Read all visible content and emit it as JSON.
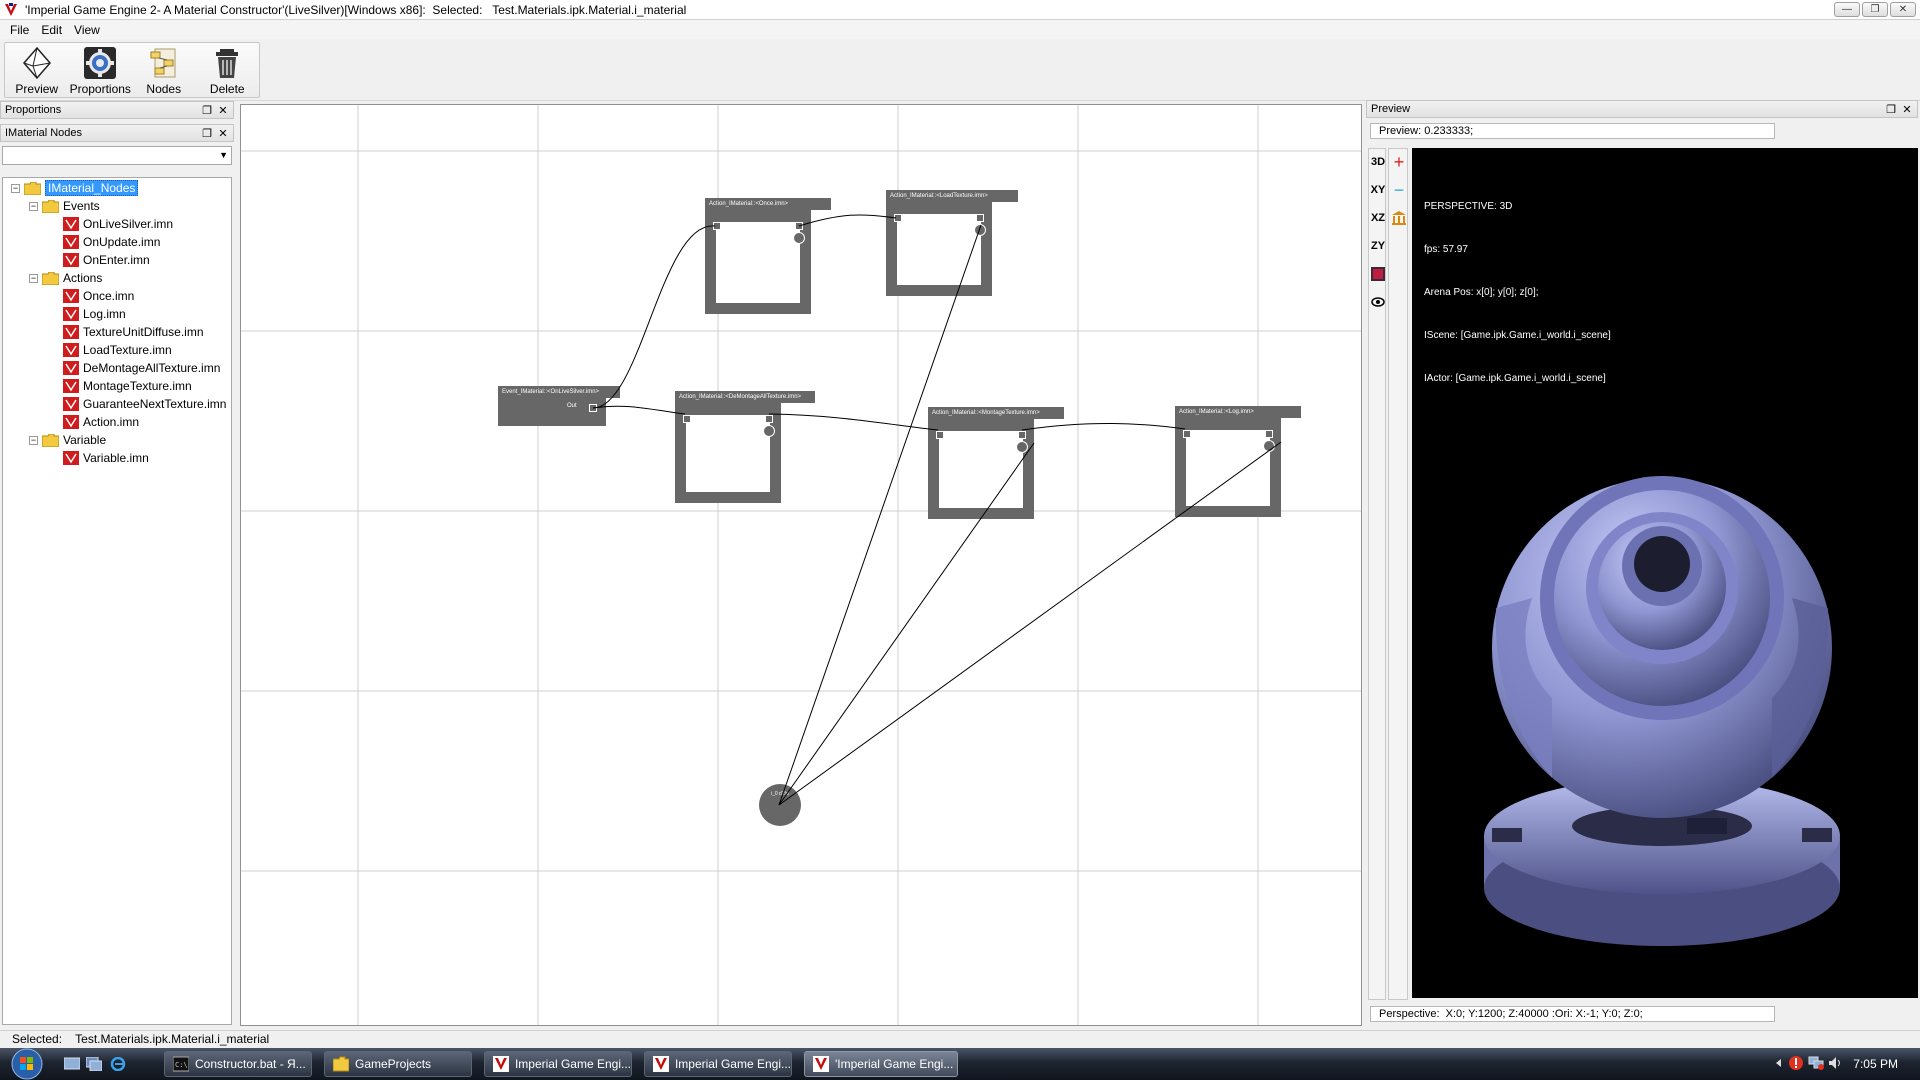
{
  "window": {
    "title": "'Imperial Game Engine 2- A Material Constructor'(LiveSilver)[Windows x86]:  Selected:   Test.Materials.ipk.Material.i_material"
  },
  "menu": [
    "File",
    "Edit",
    "View"
  ],
  "toolbar": {
    "buttons": [
      {
        "label": "Preview",
        "icon": "octahedron-icon"
      },
      {
        "label": "Proportions",
        "icon": "gear-icon"
      },
      {
        "label": "Nodes",
        "icon": "nodes-icon"
      },
      {
        "label": "Delete",
        "icon": "trash-icon"
      }
    ]
  },
  "panels": {
    "proportions": "Proportions",
    "material_nodes": "IMaterial Nodes",
    "preview": "Preview"
  },
  "tree": {
    "root": "IMaterial_Nodes",
    "groups": [
      {
        "name": "Events",
        "items": [
          "OnLiveSilver.imn",
          "OnUpdate.imn",
          "OnEnter.imn"
        ]
      },
      {
        "name": "Actions",
        "items": [
          "Once.imn",
          "Log.imn",
          "TextureUnitDiffuse.imn",
          "LoadTexture.imn",
          "DeMontageAllTexture.imn",
          "MontageTexture.imn",
          "GuaranteeNextTexture.imn",
          "Action.imn"
        ]
      },
      {
        "name": "Variable",
        "items": [
          "Variable.imn"
        ]
      }
    ]
  },
  "nodes": {
    "event": {
      "title": "Event_IMaterial::<OnLiveSilver.imn>",
      "port": "Out"
    },
    "once": {
      "title": "Action_IMaterial::<Once.imn>"
    },
    "load": {
      "title": "Action_IMaterial::<LoadTexture.imn>"
    },
    "demontage": {
      "title": "Action_IMaterial::<DeMontageAllTexture.imn>"
    },
    "montage": {
      "title": "Action_IMaterial::<MontageTexture.imn>"
    },
    "log": {
      "title": "Action_IMaterial::<Log.imn>"
    },
    "variable": {
      "title": "i_0 d2/d"
    }
  },
  "preview": {
    "field": "Preview: 0.233333;",
    "side": [
      "3D",
      "XY",
      "XZ",
      "ZY"
    ],
    "info": {
      "perspective": "PERSPECTIVE: 3D",
      "fps": "fps: 57.97",
      "arena": "Arena Pos: x[0]; y[0]; z[0];",
      "iscene": "IScene: [Game.ipk.Game.i_world.i_scene]",
      "iactor": "IActor: [Game.ipk.Game.i_world.i_scene]"
    },
    "perspective_field": "Perspective:  X:0; Y:1200; Z:40000 :Ori: X:-1; Y:0; Z:0;"
  },
  "status": "Selected:    Test.Materials.ipk.Material.i_material",
  "taskbar": {
    "tasks": [
      "Constructor.bat - Я...",
      "GameProjects",
      "Imperial Game Engi...",
      "Imperial Game Engi...",
      "'Imperial Game Engi..."
    ],
    "clock": "7:05 PM"
  },
  "colors": {
    "node": "#676767",
    "selection": "#3399ff",
    "viewport_bg": "#000000",
    "model": "#9aa0e0"
  }
}
